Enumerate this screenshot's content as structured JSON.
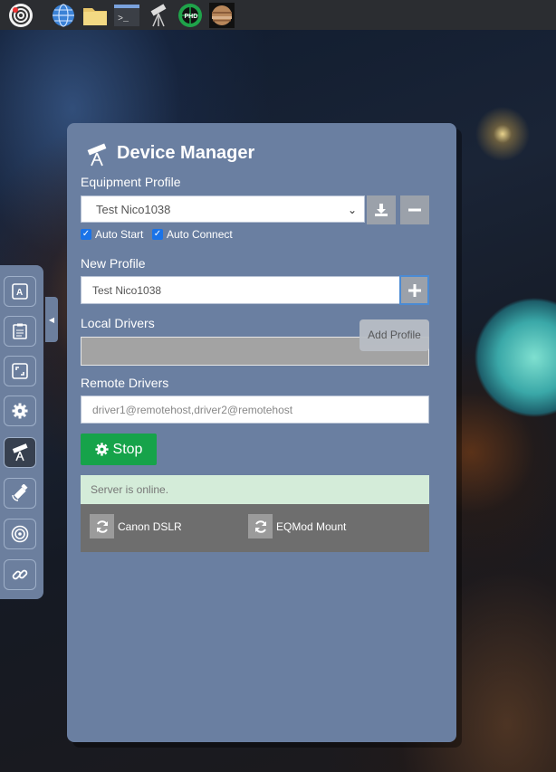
{
  "taskbar": {
    "icons": [
      "radar-icon",
      "globe-icon",
      "folder-icon",
      "terminal-icon",
      "telescope-icon",
      "phd-icon",
      "planet-icon"
    ],
    "phd_text": "PHD"
  },
  "sidebar": {
    "buttons": [
      "align-icon",
      "clipboard-icon",
      "fullscreen-icon",
      "settings-icon",
      "telescope-icon",
      "satellite-icon",
      "radar-icon",
      "link-icon"
    ],
    "active": "telescope-icon"
  },
  "panel": {
    "title": "Device Manager",
    "equipment_profile_label": "Equipment Profile",
    "profile_selected": "Test Nico1038",
    "auto_start_label": "Auto Start",
    "auto_connect_label": "Auto Connect",
    "auto_start_checked": true,
    "auto_connect_checked": true,
    "new_profile_label": "New Profile",
    "new_profile_value": "Test Nico1038",
    "add_profile_tooltip": "Add Profile",
    "local_drivers_label": "Local Drivers",
    "remote_drivers_label": "Remote Drivers",
    "remote_drivers_placeholder": "driver1@remotehost,driver2@remotehost",
    "stop_label": "Stop",
    "server_status": "Server is online.",
    "drivers": [
      {
        "name": "Canon DSLR"
      },
      {
        "name": "EQMod Mount"
      }
    ]
  },
  "colors": {
    "panel": "#6a7fa1",
    "stop": "#16a34a",
    "status_bg": "#d4ecd9",
    "drivers_bg": "#6e6e6e"
  }
}
